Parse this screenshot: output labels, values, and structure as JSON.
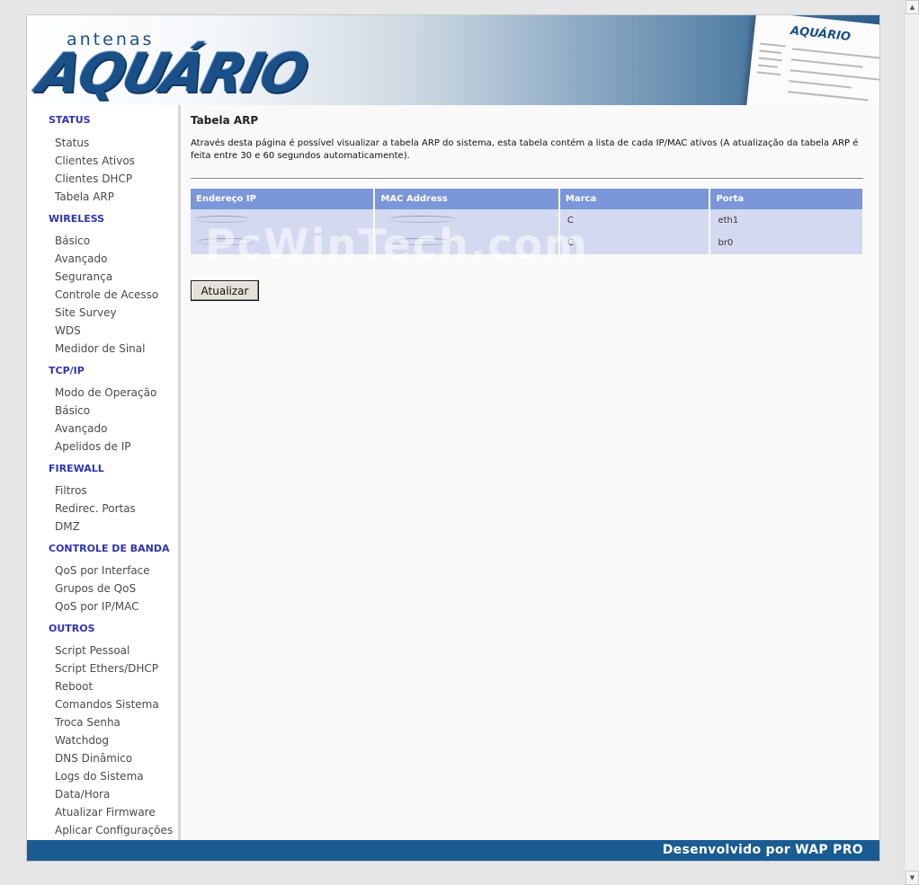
{
  "header": {
    "logo_top": "antenas",
    "logo_main": "AQUÁRIO",
    "thumb_logo": "AQUÁRIO"
  },
  "sidebar": {
    "sections": [
      {
        "title": "STATUS",
        "items": [
          "Status",
          "Clientes Ativos",
          "Clientes DHCP",
          "Tabela ARP"
        ]
      },
      {
        "title": "WIRELESS",
        "items": [
          "Básico",
          "Avançado",
          "Segurança",
          "Controle de Acesso",
          "Site Survey",
          "WDS",
          "Medidor de Sinal"
        ]
      },
      {
        "title": "TCP/IP",
        "items": [
          "Modo de Operação",
          "Básico",
          "Avançado",
          "Apelidos de IP"
        ]
      },
      {
        "title": "FIREWALL",
        "items": [
          "Filtros",
          "Redirec. Portas",
          "DMZ"
        ]
      },
      {
        "title": "CONTROLE DE BANDA",
        "items": [
          "QoS por Interface",
          "Grupos de QoS",
          "QoS por IP/MAC"
        ]
      },
      {
        "title": "OUTROS",
        "items": [
          "Script Pessoal",
          "Script Ethers/DHCP",
          "Reboot",
          "Comandos Sistema",
          "Troca Senha",
          "Watchdog",
          "DNS Dinâmico",
          "Logs do Sistema",
          "Data/Hora",
          "Atualizar Firmware",
          "Aplicar Configurações"
        ]
      }
    ]
  },
  "main": {
    "title": "Tabela ARP",
    "description": "Através desta página é possível visualizar a tabela ARP do sistema, esta tabela contém a lista de cada IP/MAC ativos (A atualização da tabela ARP é feita entre 30 e 60 segundos automaticamente).",
    "table": {
      "headers": [
        "Endereço IP",
        "MAC Address",
        "Marca",
        "Porta"
      ],
      "rows": [
        {
          "marca": "C",
          "porta": "eth1"
        },
        {
          "marca": "C",
          "porta": "br0"
        }
      ]
    },
    "watermark": "PcWinTech.com",
    "refresh_button": "Atualizar"
  },
  "footer": {
    "text": "Desenvolvido por WAP PRO"
  },
  "colors": {
    "section_title": "#2e34b4",
    "table_header": "#7b96d9",
    "table_cell": "#d3d9ef",
    "footer": "#1a5b92"
  }
}
